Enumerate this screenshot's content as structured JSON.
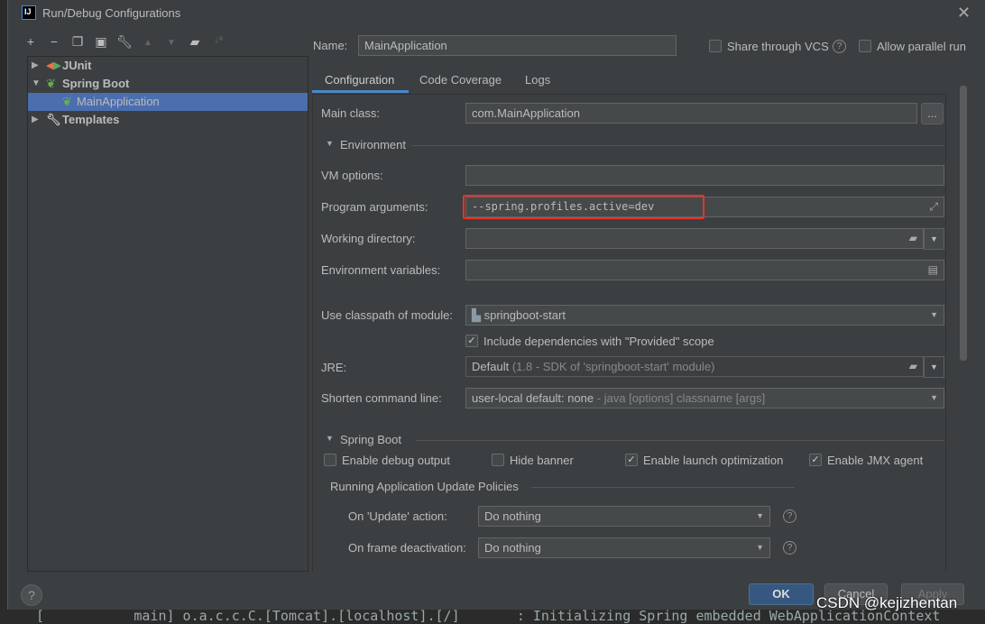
{
  "window": {
    "title": "Run/Debug Configurations",
    "logo": "IJ"
  },
  "toolbar": {
    "icons": [
      "plus-icon",
      "minus-icon",
      "copy-icon",
      "save-icon",
      "wrench-icon",
      "arrow-up-icon",
      "arrow-down-icon",
      "new-folder-icon",
      "sort-icon"
    ]
  },
  "tree": {
    "items": [
      {
        "label": "JUnit",
        "icon": "junit-icon",
        "expanded": false
      },
      {
        "label": "Spring Boot",
        "icon": "spring-boot-icon",
        "expanded": true
      },
      {
        "label": "MainApplication",
        "icon": "spring-boot-icon",
        "selected": true
      },
      {
        "label": "Templates",
        "icon": "wrench-icon",
        "expanded": false
      }
    ]
  },
  "name": {
    "label": "Name:",
    "value": "MainApplication"
  },
  "share_vcs": {
    "label": "Share through VCS",
    "checked": false
  },
  "parallel": {
    "label": "Allow parallel run",
    "checked": false
  },
  "tabs": [
    {
      "label": "Configuration",
      "active": true
    },
    {
      "label": "Code Coverage"
    },
    {
      "label": "Logs"
    }
  ],
  "form": {
    "main_class": {
      "label": "Main class:",
      "value": "com.MainApplication",
      "browse": "..."
    },
    "environment": "Environment",
    "vm_options": {
      "label": "VM options:",
      "value": ""
    },
    "program_args": {
      "label": "Program arguments:",
      "value": "--spring.profiles.active=dev",
      "highlight": "#e5332a"
    },
    "working_dir": {
      "label": "Working directory:",
      "value": ""
    },
    "env_vars": {
      "label": "Environment variables:",
      "value": ""
    },
    "classpath": {
      "label": "Use classpath of module:",
      "value": "springboot-start"
    },
    "include_provided": {
      "label": "Include dependencies with \"Provided\" scope",
      "checked": true
    },
    "jre": {
      "label": "JRE:",
      "value": "Default",
      "hint": "(1.8 - SDK of 'springboot-start' module)"
    },
    "shorten": {
      "label": "Shorten command line:",
      "value": "user-local default: none",
      "hint": "- java [options] classname [args]"
    }
  },
  "spring_boot": {
    "title": "Spring Boot",
    "debug": {
      "label": "Enable debug output",
      "checked": false
    },
    "banner": {
      "label": "Hide banner",
      "checked": false
    },
    "launch_opt": {
      "label": "Enable launch optimization",
      "checked": true
    },
    "jmx": {
      "label": "Enable JMX agent",
      "checked": true
    },
    "policies": "Running Application Update Policies",
    "update_action": {
      "label": "On 'Update' action:",
      "value": "Do nothing"
    },
    "frame_deactivation": {
      "label": "On frame deactivation:",
      "value": "Do nothing"
    }
  },
  "buttons": {
    "help": "?",
    "ok": "OK",
    "cancel": "Cancel",
    "apply": "Apply"
  },
  "watermark": "CSDN @kejizhentan",
  "background_log": "[           main] o.a.c.c.C.[Tomcat].[localhost].[/]       : Initializing Spring embedded WebApplicationContext"
}
